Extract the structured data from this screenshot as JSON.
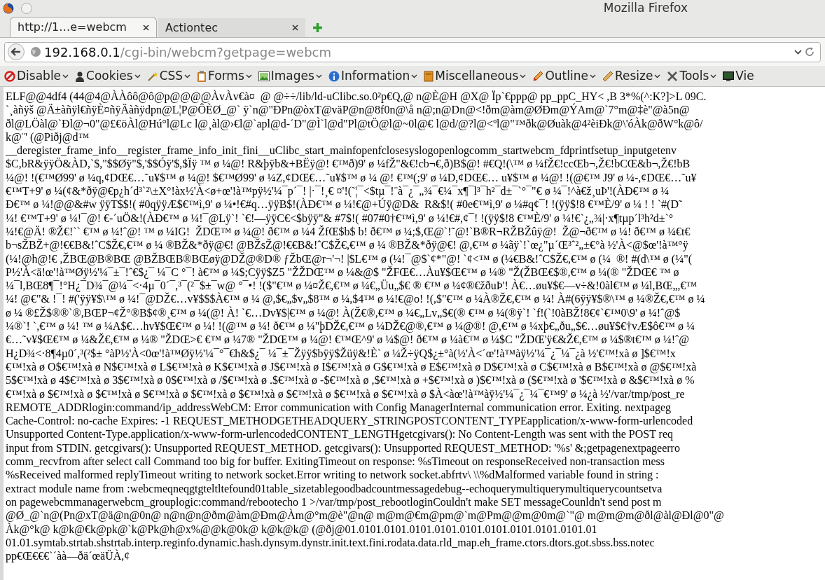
{
  "window": {
    "title": "Mozilla Firefox"
  },
  "tabs": [
    {
      "label": "http://1…e=webcm",
      "selected": true
    },
    {
      "label": "Actiontec",
      "selected": false
    }
  ],
  "address_bar": {
    "host": "192.168.0.1",
    "path": "/cgi-bin/webcm?getpage=webcm"
  },
  "toolbar": [
    {
      "label": "Disable",
      "kind": "disable"
    },
    {
      "label": "Cookies",
      "kind": "cookies"
    },
    {
      "label": "CSS",
      "kind": "css"
    },
    {
      "label": "Forms",
      "kind": "forms"
    },
    {
      "label": "Images",
      "kind": "images"
    },
    {
      "label": "Information",
      "kind": "information"
    },
    {
      "label": "Miscellaneous",
      "kind": "miscellaneous"
    },
    {
      "label": "Outline",
      "kind": "outline"
    },
    {
      "label": "Resize",
      "kind": "resize"
    },
    {
      "label": "Tools",
      "kind": "tools"
    },
    {
      "label": "Vie",
      "kind": "view"
    }
  ],
  "content": {
    "lines": [
      "ELF@@4df4 (44@4@ÀÀôô@ô@p@@@@ÀvÀv€à¤  @ @÷÷/lib/ld-uClibc.so.0²p€Q,@ n@È@H @X@ Ïp`€ppp@ pp_ppC_HY< ,B 3*%(^:K?]>L 09C.",
      "`¸àñÿš @Ä±àñÿl€ñÿÈ¤ñÿÄàñÿdpn@L¦P@ÔÈØ_@` ÿ`n@\"ÐPn@òxT@väP@n@8f0n@\\å n@;n@Dn@<!ðm@àm@ØÐm@ÝAm@`7°m@‡è\"@à5n@",
      "ðl@LÖàl@`Ðl@¬0\"@£€öÀl@Hú°l@Lc l@¸àl@›€l@`apl@d-´D\"@Ì`l@d\"Pl@tÖ@l@~0l@€ l@d/@?l@<ºl@\"™ðk@Øuàk@4²èiÐk@\\'óÀk@ðW°k@ô/",
      "k@¨' (@Piðj@d™",
      "__deregister_frame_info__register_frame_info_init_fini__uClibc_start_mainfopenfclosesyslogopenlogcomm_startwebcm_fdprintfsetup_inputgetenv",
      "$C,bR&ÿÿÖ&ÀD,`$,\"$$Øÿ\"$,'$$Óÿ'$,$Ïÿ ™ ø ¼@! R&þÿb&+BËÿ@! €™ð)9' ø ¼fŽ\"&€!cb¬€,ð)B$@! #€Q!(\\™ ø ¼fŽ€!ccŒb¬,Ž€!bCŒ&b¬,Ž€!bB",
      "¼@! !(€™Ø99' ø ¼q,¢DŒ€…˜u¥$™ ø ¼@! $€™Ø99' ø ¼Z,¢DŒ€…˜u¥$™ ø ¼ @! €™(;9' ø ¼D,¢DŒ€… u¥$™ ø ¼@! !(@€™ J9' ø ¼-,¢DŒ€…˜u¥",
      "€™T+9' ø ¼(¢&*ðÿ@€p¿h´d³`²\\±X°!àx½'À<ø+œ'!à™pÿ½'¼¯p´¯! |·¯!¸€ ¤'!(˜¦¯<$tµ¯!¨à¯¿¯„¾¯€¼¯x¶¯l³¯h²¯d±¯`°¯\"€ ø ¼¯!^à€ž¸uÞ'!(ÀÐ€™ ø ¼",
      "Ð€™ ø ¼!@@&#w ÿÿT$$!( #0qÿÿÆ$€™ì,9' ø ¼•!€#q…ÿÿB$!(ÀÐ€™ ø ¼!€@+Úÿ@D&  R&$!( #0e€™ì,9' ø ¼#q¢¯! !(ÿÿ$!8 €™È/9' ø ¼ ! ! `#(D˜",
      "¼! €™T+9' ø ¼!¯@! €-´uÖ&!(ÀÐ€™ ø ¼!¯@Lÿ`! `€!—ÿÿC€<$bÿÿ\"& #7$!( #07#0†€™ì,9' ø ¼!€#,¢¯! !(ÿÿ$!8 €™È/9' ø ¼!€`¿„¾|·x¶tµp´l³h²d±`°",
      "¼!€@Ä! ®Ž€!`` €™ ø ¼!ˆ@! ™ ø ¼IG!  ŽDŒ™ ø ¼@! ð€™ ø ¼4 ŽfŒ$b$ b! ð€™ ø ¼;$,Œ@`!˜@!`B®R¬RŽBŽûÿ@!  Ž@¬ð€™ ø ¼! ð€™ ø ¼€t€",
      "b¬sŽBŽ+@!€€B&!ˆC$Ž€,€™ ø ¼ ®BŽ&*ðÿ@€! @BŽsŽ@!€€B&!ˆC$Ž€,€™ ø ¼ ®BŽ&*ðÿ@€! @,€™ ø ¼ãÿ`!`œ¿\"µ´Œ³ˆ²„±€°à ½'À<@$œ'!à™°ÿ",
      "(¼!@h@!€ ,ŽBŒ@B®BŒ @BŽBŒB®BŒøÿ@DŽ@®D® ƒŽbŒ@r¬'¬! |$L€™ ø (¼!¯@$`¢*\"@! `¢<™ ø (¼€B&!ˆC$Ž€,€™ ø (¼  ®! #(d\\™ ø (¼\"(",
      "P½'À<ä!œ'!à™Øÿ½'¼¯±¯!ˆ€$¿¯ ¼¯C °¯! à€™ ø ¼$;Cÿÿ$Z5 \"ŽŽDŒ™ ø ¼&@$ \"ŽFŒ€…Àu¥$Œ€™ ø ¼® \"Ž(ŽBŒ€$®,€™ ø ¼(® \"ŽDŒ€ ™ ø",
      "¼¯l,BŒ8¶¯!°H¿¯D¾¯@¼¯<·4µ¯0´¯,³¯(²¯$±¯w@ °¯•! !($\"€™ ø ¼¤Ž€,€™ ø ¼€„Üu„$€ ® €™ ø ¼¢®€žðuÞ'! À€…øu¥$€—v÷&!0àl€™ ø ¼l,BŒ„,€™",
      "¼! @€\"& !¯! #('ÿÿ¥$\\™ ø ¼!¯@DŽ€…v¥$$$À€™ ø ¼ @,$€„$v„$8™ ø ¼,$4™ ø ¼!€@o! !(,$\"€™ ø ¼À®Ž€,€™ ø ¼! À#(6ÿÿ¥$®\\™ ø ¼®Ž€,€™ ø ¼",
      "ø ¼ ®£Ž$®®`®,BŒP¬¢Ž°®B$¢®¸€™ ø ¼(@! À! `€…Dv¥$|€™ ø ¼@! À(Ž€®,€™ ø ¼€„Lv„$€(® €™ ø ¼(®ÿ`! `f!(`!0àBŽ!8€¢`€™0\\9' ø ¼!ˆ@$",
      "¼®`! `,€™ ø ¼! ™ ø ¼A$€…hv¥$Œ€™ ø ¼! !(@™ ø ¼! ð€™ ø ¼\"þDŽ€,€™ ø ¼DŽ€@®,€™ ø ¼@®! @,€™ ø ¼xþ€„ðu„$€…øu¥$€†vÆ$ô€™ ø ¼",
      "€…˜v¥$Œ€™ ø ¼&Ž€,€™ ø ¼® \"ŽDŒ>€ €™ ø ¼7® \"ŽDŒ™ ø ¼@! €™Œ^9' ø ¼$@! ð€™ ø ¼à€™ ø ¼$C \"ŽDŒ'ÿ€&Ž€,€™ ø ¼$®t€™ ø ¼!ˆ@",
      "H¿D¾<·8¶4µ0´,³(²$± °àP½'À<0œ'!à™Øÿ½'¼¯°¯€h&$¿¯ ¼¯±¯Žÿÿ$bÿÿ$Žüÿ&!È` ø ¼Ž÷ÿQ$¿±°à(½'À<´œ'!à™àÿ½'¼¯¿¯¼¯¿à ½'€™!xà ø ]$€™!x",
      "€™!xà ø O$€™!xà ø N$€™!xà ø L$€™!xà ø K$€™!xà ø J$€™!xà ø I$€™!xà ø G$€™!xà ø E$€™!xà ø D$€™!xà ø C$€™!xà ø B$€™!xà ø @$€™!xà",
      "5$€™!xà ø 4$€™!xà ø 3$€™!xà ø 0$€™!xà ø /$€™!xà ø .$€™!xà ø -$€™!xà ø ,$€™!xà ø +$€™!xà ø )$€™!xà ø ($€™!xà ø '$€™!xà ø &$€™!xà ø %",
      "€™!xà ø $€™!xà ø $€™!xà ø $€™!xà ø $€™!xà ø $€™!xà ø $€™!xà ø $€™!xà ø $€™!xà ø $À<àœ'!à™àÿ½'¼¯¿¯¼¯€™9' ø ¼¿à ½'/var/tmp/post_re",
      "REMOTE_ADDRlogin:command/ip_addressWebCM: Error communication with Config ManagerInternal communication error. Exiting. nextpageg",
      "Cache-Control: no-cache Expires: -1 REQUEST_METHODGETHEADQUERY_STRINGPOSTCONTENT_TYPEapplication/x-www-form-urlencoded",
      "Unsupported Content-Type.application/x-www-form-urlencodedCONTENT_LENGTHgetcgivars(): No Content-Length was sent with the POST req",
      "input from STDIN. getcgivars(): Unsupported REQUEST_METHOD. getcgivars(): Unsupported REQUEST_METHOD: '%s' &;getpagenextpageerro",
      "comm_recvfrom after select call Command too big for buffer. ExitingTimeout on response: %sTimeout on responseReceived non-transaction mess",
      "%sReceived malformed replyTimeout writing to network socket.Error writing to network socket.abfrtv\\ \\\\%dMalformed variable found in string :",
      "extract module name from :webcmeqneqgtgteltltefound01table_sizetablegoodbadcountmessagedebug--echoquerymultiquerymultiquerycountsetva",
      "on pagewebcmmanagerwebcm_grouplogic:command/rebootecho 1 >/var/tmp/post_rebootloginCouldn't make SET messageCounldn't send post m",
      "@Ø_@`n@(Pn@xT@ä@n@0n@ n@n@n@ðm@àm@Ðm@Àm@°m@è\"@n@ m@m@€m@pm@`m@Pm@@m@0m@`\"@ m@m@m@ðl@àl@Ðl@0\"@",
      "Àk@°k@ k@k@€k@pk@`k@Pk@h@x%@@k@0k@ k@k@k@ (@ðj@01.0101.0101.0101.0101.0101.0101.0101.0101.0101.01",
      "01.01.symtab.strtab.shstrtab.interp.reginfo.dynamic.hash.dynsym.dynstr.init.text.fini.rodata.data.rld_map.eh_frame.ctors.dtors.got.sbss.bss.notec",
      "pp€Œ€€€`´àà—ðä´œäÜÀ,¢"
    ]
  }
}
